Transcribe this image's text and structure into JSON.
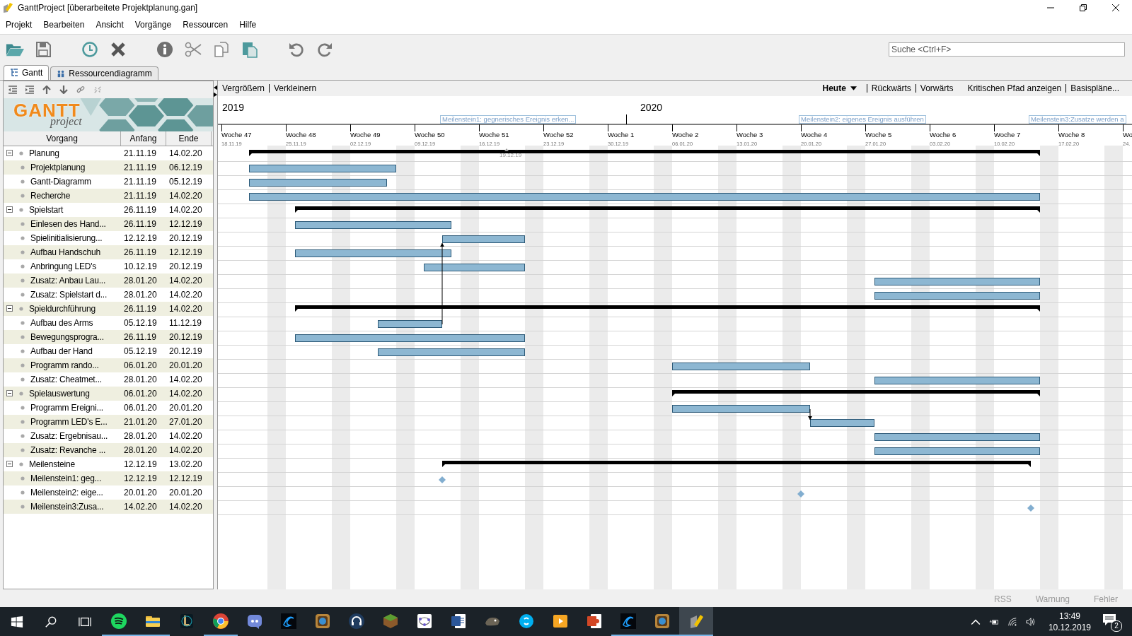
{
  "window": {
    "title": "GanttProject [überarbeitete Projektplanung.gan]"
  },
  "menu": [
    "Projekt",
    "Bearbeiten",
    "Ansicht",
    "Vorgänge",
    "Ressourcen",
    "Hilfe"
  ],
  "search": {
    "placeholder": "Suche <Ctrl+F>"
  },
  "tabs": [
    {
      "label": "Gantt",
      "selected": true
    },
    {
      "label": "Ressourcendiagramm",
      "selected": false
    }
  ],
  "logo": {
    "title": "GANTT",
    "subtitle": "project"
  },
  "columns": [
    "Vorgang",
    "Anfang",
    "Ende"
  ],
  "zoom_links": [
    "Vergrößern",
    "Verkleinern"
  ],
  "nav": {
    "today": "Heute",
    "links": [
      "Rückwärts",
      "Vorwärts"
    ],
    "extra": [
      "Kritischen Pfad anzeigen",
      "Basispläne..."
    ]
  },
  "timeline": {
    "years": [
      {
        "label": "2019"
      },
      {
        "label": "2020"
      }
    ],
    "weeks": [
      {
        "label": "Woche 47",
        "date": "18.11.19"
      },
      {
        "label": "Woche 48",
        "date": "25.11.19"
      },
      {
        "label": "Woche 49",
        "date": "02.12.19"
      },
      {
        "label": "Woche 50",
        "date": "09.12.19"
      },
      {
        "label": "Woche 51",
        "date": "16.12.19"
      },
      {
        "label": "Woche 52",
        "date": "23.12.19"
      },
      {
        "label": "Woche 1",
        "date": "30.12.19"
      },
      {
        "label": "Woche 2",
        "date": "06.01.20"
      },
      {
        "label": "Woche 3",
        "date": "13.01.20"
      },
      {
        "label": "Woche 4",
        "date": "20.01.20"
      },
      {
        "label": "Woche 5",
        "date": "27.01.20"
      },
      {
        "label": "Woche 6",
        "date": "03.02.20"
      },
      {
        "label": "Woche 7",
        "date": "10.02.20"
      },
      {
        "label": "Woche 8",
        "date": "17.02.20"
      },
      {
        "label": "Wo",
        "date": "24."
      }
    ],
    "date_marker": "19.12.19"
  },
  "tasks": [
    {
      "name": "Planung",
      "start": "21.11.19",
      "end": "14.02.20",
      "kind": "group",
      "expanded": true,
      "children": [
        {
          "name": "Projektplanung",
          "start": "21.11.19",
          "end": "06.12.19",
          "kind": "task"
        },
        {
          "name": "Gantt-Diagramm",
          "start": "21.11.19",
          "end": "05.12.19",
          "kind": "task"
        },
        {
          "name": "Recherche",
          "start": "21.11.19",
          "end": "14.02.20",
          "kind": "task"
        }
      ]
    },
    {
      "name": "Spielstart",
      "start": "26.11.19",
      "end": "14.02.20",
      "kind": "group",
      "expanded": true,
      "children": [
        {
          "name": "Einlesen des Hand...",
          "start": "26.11.19",
          "end": "12.12.19",
          "kind": "task"
        },
        {
          "name": "Spielinitialisierung...",
          "start": "12.12.19",
          "end": "20.12.19",
          "kind": "task"
        },
        {
          "name": "Aufbau Handschuh",
          "start": "26.11.19",
          "end": "12.12.19",
          "kind": "task"
        },
        {
          "name": "Anbringung LED's",
          "start": "10.12.19",
          "end": "20.12.19",
          "kind": "task"
        },
        {
          "name": "Zusatz: Anbau Lau...",
          "start": "28.01.20",
          "end": "14.02.20",
          "kind": "task"
        },
        {
          "name": "Zusatz: Spielstart d...",
          "start": "28.01.20",
          "end": "14.02.20",
          "kind": "task"
        }
      ]
    },
    {
      "name": "Spieldurchführung",
      "start": "26.11.19",
      "end": "14.02.20",
      "kind": "group",
      "expanded": true,
      "children": [
        {
          "name": "Aufbau des Arms",
          "start": "05.12.19",
          "end": "11.12.19",
          "kind": "task",
          "link_up": true
        },
        {
          "name": "Bewegungsprogra...",
          "start": "26.11.19",
          "end": "20.12.19",
          "kind": "task"
        },
        {
          "name": "Aufbau der Hand",
          "start": "05.12.19",
          "end": "20.12.19",
          "kind": "task"
        },
        {
          "name": "Programm rando...",
          "start": "06.01.20",
          "end": "20.01.20",
          "kind": "task"
        },
        {
          "name": "Zusatz: Cheatmet...",
          "start": "28.01.20",
          "end": "14.02.20",
          "kind": "task"
        }
      ]
    },
    {
      "name": "Spielauswertung",
      "start": "06.01.20",
      "end": "14.02.20",
      "kind": "group",
      "expanded": true,
      "children": [
        {
          "name": "Programm Ereigni...",
          "start": "06.01.20",
          "end": "20.01.20",
          "kind": "task",
          "link_down": true
        },
        {
          "name": "Programm LED's E...",
          "start": "21.01.20",
          "end": "27.01.20",
          "kind": "task"
        },
        {
          "name": "Zusatz: Ergebnisau...",
          "start": "28.01.20",
          "end": "14.02.20",
          "kind": "task"
        },
        {
          "name": "Zusatz: Revanche ...",
          "start": "28.01.20",
          "end": "14.02.20",
          "kind": "task"
        }
      ]
    },
    {
      "name": "Meilensteine",
      "start": "12.12.19",
      "end": "13.02.20",
      "kind": "group",
      "expanded": true,
      "children": [
        {
          "name": "Meilenstein1: geg...",
          "start": "12.12.19",
          "end": "12.12.19",
          "kind": "milestone",
          "timeline_label": "Meilenstein1: gegnerisches Ereignis erken..."
        },
        {
          "name": "Meilenstein2: eige...",
          "start": "20.01.20",
          "end": "20.01.20",
          "kind": "milestone",
          "timeline_label": "Meilenstein2: eigenes Ereignis ausführen"
        },
        {
          "name": "Meilenstein3:Zusa...",
          "start": "14.02.20",
          "end": "14.02.20",
          "kind": "milestone",
          "timeline_label": "Meilenstein3:Zusatze werden a"
        }
      ]
    }
  ],
  "status_bar": [
    "RSS",
    "Warnung",
    "Fehler"
  ],
  "taskbar": {
    "apps": [
      {
        "running": true,
        "active": false
      },
      {
        "running": true,
        "active": false
      },
      {
        "running": false,
        "active": false
      },
      {
        "running": true,
        "active": false
      },
      {
        "running": false,
        "active": false
      },
      {
        "running": false,
        "active": false
      },
      {
        "running": false,
        "active": false
      },
      {
        "running": false,
        "active": false
      },
      {
        "running": false,
        "active": false
      },
      {
        "running": false,
        "active": false
      },
      {
        "running": false,
        "active": false
      },
      {
        "running": false,
        "active": false
      },
      {
        "running": false,
        "active": false
      },
      {
        "running": false,
        "active": false
      },
      {
        "running": false,
        "active": false
      },
      {
        "running": true,
        "active": false
      },
      {
        "running": true,
        "active": false
      },
      {
        "running": true,
        "active": true
      }
    ],
    "time": "13:49",
    "date": "10.12.2019",
    "notifications": "2"
  }
}
